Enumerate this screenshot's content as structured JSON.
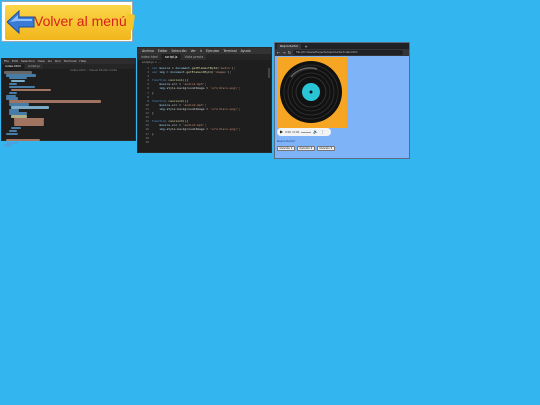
{
  "back_button": {
    "label": "Volver al menú"
  },
  "editor_window": {
    "menu": [
      "File",
      "Edit",
      "Selection",
      "View",
      "Go",
      "Run",
      "Terminal",
      "Help"
    ],
    "tabs": [
      {
        "label": "index.html"
      },
      {
        "label": "script.js"
      }
    ],
    "title": "index.html - Visual Studio Code",
    "code_lines": [
      {
        "indent": 0,
        "len": 28,
        "color": "#808080"
      },
      {
        "indent": 2,
        "len": 30,
        "color": "#569cd6"
      },
      {
        "indent": 4,
        "len": 18,
        "color": "#569cd6"
      },
      {
        "indent": 6,
        "len": 14,
        "color": "#9cdcfe"
      },
      {
        "indent": 4,
        "len": 8,
        "color": "#569cd6"
      },
      {
        "indent": 4,
        "len": 26,
        "color": "#569cd6"
      },
      {
        "indent": 6,
        "len": 40,
        "color": "#ce9178"
      },
      {
        "indent": 4,
        "len": 8,
        "color": "#569cd6"
      },
      {
        "indent": 2,
        "len": 10,
        "color": "#569cd6"
      },
      {
        "indent": 2,
        "len": 12,
        "color": "#569cd6"
      },
      {
        "indent": 4,
        "len": 92,
        "color": "#ce9178"
      },
      {
        "indent": 4,
        "len": 20,
        "color": "#569cd6"
      },
      {
        "indent": 6,
        "len": 38,
        "color": "#9cdcfe"
      },
      {
        "indent": 4,
        "len": 10,
        "color": "#569cd6"
      },
      {
        "indent": 4,
        "len": 18,
        "color": "#569cd6"
      },
      {
        "indent": 6,
        "len": 16,
        "color": "#dcdcaa"
      },
      {
        "indent": 8,
        "len": 30,
        "color": "#ce9178"
      },
      {
        "indent": 8,
        "len": 30,
        "color": "#ce9178"
      },
      {
        "indent": 8,
        "len": 30,
        "color": "#ce9178"
      },
      {
        "indent": 6,
        "len": 10,
        "color": "#569cd6"
      },
      {
        "indent": 4,
        "len": 8,
        "color": "#569cd6"
      },
      {
        "indent": 2,
        "len": 12,
        "color": "#569cd6"
      },
      {
        "indent": 0,
        "len": 0,
        "color": "#1e1e1e"
      },
      {
        "indent": 2,
        "len": 34,
        "color": "#ce9178"
      },
      {
        "indent": 2,
        "len": 12,
        "color": "#569cd6"
      },
      {
        "indent": 0,
        "len": 8,
        "color": "#569cd6"
      }
    ]
  },
  "script_window": {
    "menu": [
      "Archivo",
      "Editar",
      "Selección",
      "Ver",
      "Ir",
      "Ejecutar",
      "Terminal",
      "Ayuda"
    ],
    "tabs": [
      {
        "label": "index.html"
      },
      {
        "label": "script.js"
      },
      {
        "label": "Vista previa"
      }
    ],
    "breadcrumb": "script.js > ...",
    "line_numbers": [
      "1",
      "2",
      "3",
      "4",
      "5",
      "6",
      "7",
      "8",
      "9",
      "10",
      "11",
      "12",
      "13",
      "14",
      "15",
      "16",
      "17",
      "18",
      "19"
    ],
    "code": [
      "var musica = document.getElementById('audio');",
      "var img = document.getElementById('imagen');",
      "",
      "function cancion1(){",
      "    musica.src = 'audio1.mp3';",
      "    img.style.backgroundImage = 'url(disco.png)';",
      "}",
      "",
      "function cancion2(){",
      "    musica.src = 'audio2.mp3';",
      "    img.style.backgroundImage = 'url(disco.png)';",
      "}",
      "",
      "function cancion3(){",
      "    musica.src = 'audio3.mp3';",
      "    img.style.backgroundImage = 'url(disco.png)';",
      "}",
      "",
      ""
    ]
  },
  "browser_window": {
    "tab_label": "Reproductor",
    "url": "file:///C:/Users/Proyecto/reproductor/index.html",
    "player": {
      "time": "0:00 / 0:00"
    },
    "controls_label": "Reproductor",
    "buttons": [
      "Canción 1",
      "Canción 2",
      "Canción 3"
    ],
    "cover_color": "#f6a623"
  }
}
